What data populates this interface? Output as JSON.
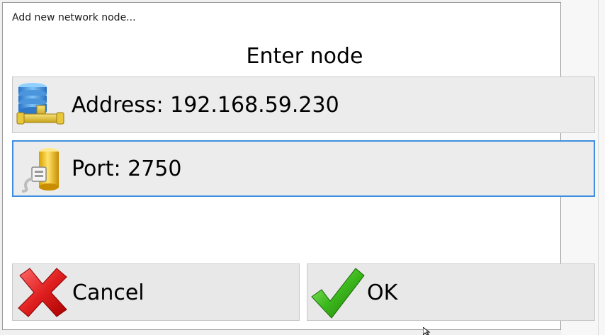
{
  "window": {
    "title": "Add new network node..."
  },
  "dialog": {
    "heading": "Enter node",
    "address": {
      "label": "Address: 192.168.59.230",
      "icon": "database-network-icon"
    },
    "port": {
      "label": "Port: 2750",
      "icon": "port-plug-icon"
    }
  },
  "buttons": {
    "cancel_label": "Cancel",
    "ok_label": "OK"
  },
  "colors": {
    "focus_border": "#3d8ee0",
    "field_bg": "#ececec",
    "button_bg": "#e8e8e8"
  }
}
